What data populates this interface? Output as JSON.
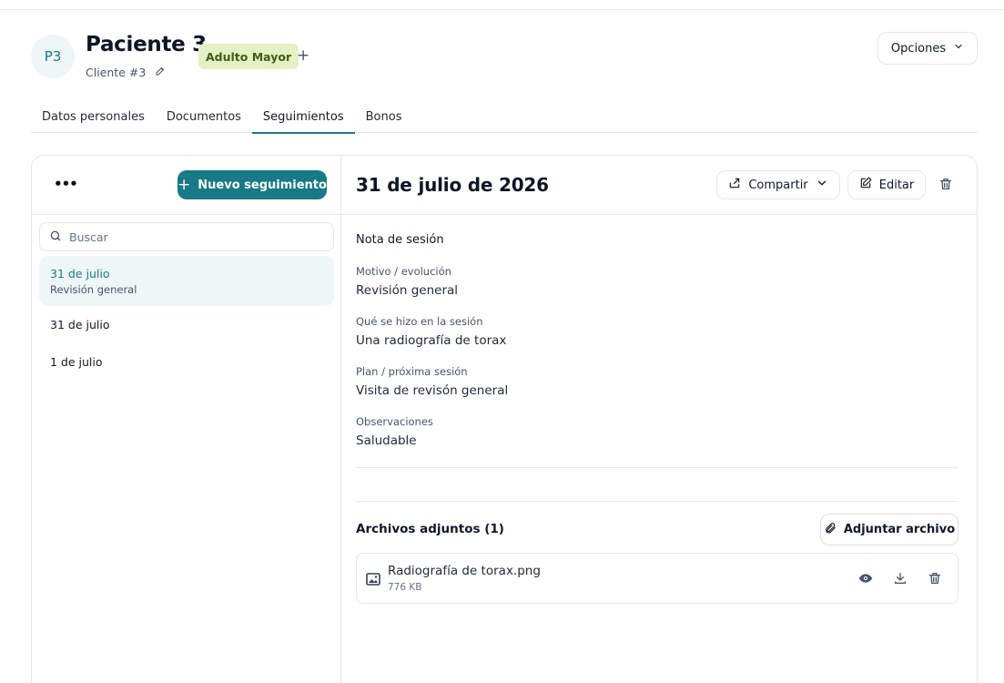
{
  "header": {
    "avatar_initials": "P3",
    "patient_name": "Paciente 3",
    "client_label": "Cliente #3",
    "badge": "Adulto Mayor",
    "add_tag_symbol": "+",
    "options_label": "Opciones"
  },
  "tabs": [
    {
      "label": "Datos personales",
      "active": false
    },
    {
      "label": "Documentos",
      "active": false
    },
    {
      "label": "Seguimientos",
      "active": true
    },
    {
      "label": "Bonos",
      "active": false
    }
  ],
  "sidebar": {
    "more_label": "•••",
    "new_button_label": "Nuevo seguimiento",
    "search_placeholder": "Buscar",
    "items": [
      {
        "date": "31 de julio",
        "subtitle": "Revisión general",
        "selected": true
      },
      {
        "date": "31 de julio",
        "subtitle": "",
        "selected": false
      },
      {
        "date": "1 de julio",
        "subtitle": "",
        "selected": false
      }
    ]
  },
  "detail": {
    "date_title": "31 de julio de 2026",
    "share_label": "Compartir",
    "edit_label": "Editar",
    "note_title": "Nota de sesión",
    "fields": [
      {
        "label": "Motivo / evolución",
        "value": "Revisión general"
      },
      {
        "label": "Qué se hizo en la sesión",
        "value": "Una radiografía de torax"
      },
      {
        "label": "Plan / próxima sesión",
        "value": "Visita de revisón general"
      },
      {
        "label": "Observaciones",
        "value": "Saludable"
      }
    ],
    "attachments_title": "Archivos adjuntos (1)",
    "attach_button_label": "Adjuntar archivo",
    "files": [
      {
        "name": "Radiografía de torax.png",
        "size": "776 KB"
      }
    ]
  },
  "colors": {
    "accent": "#177a86",
    "badge_bg": "#e3f1c5",
    "badge_text": "#4b5a12",
    "selected_bg": "#eef6f7"
  }
}
